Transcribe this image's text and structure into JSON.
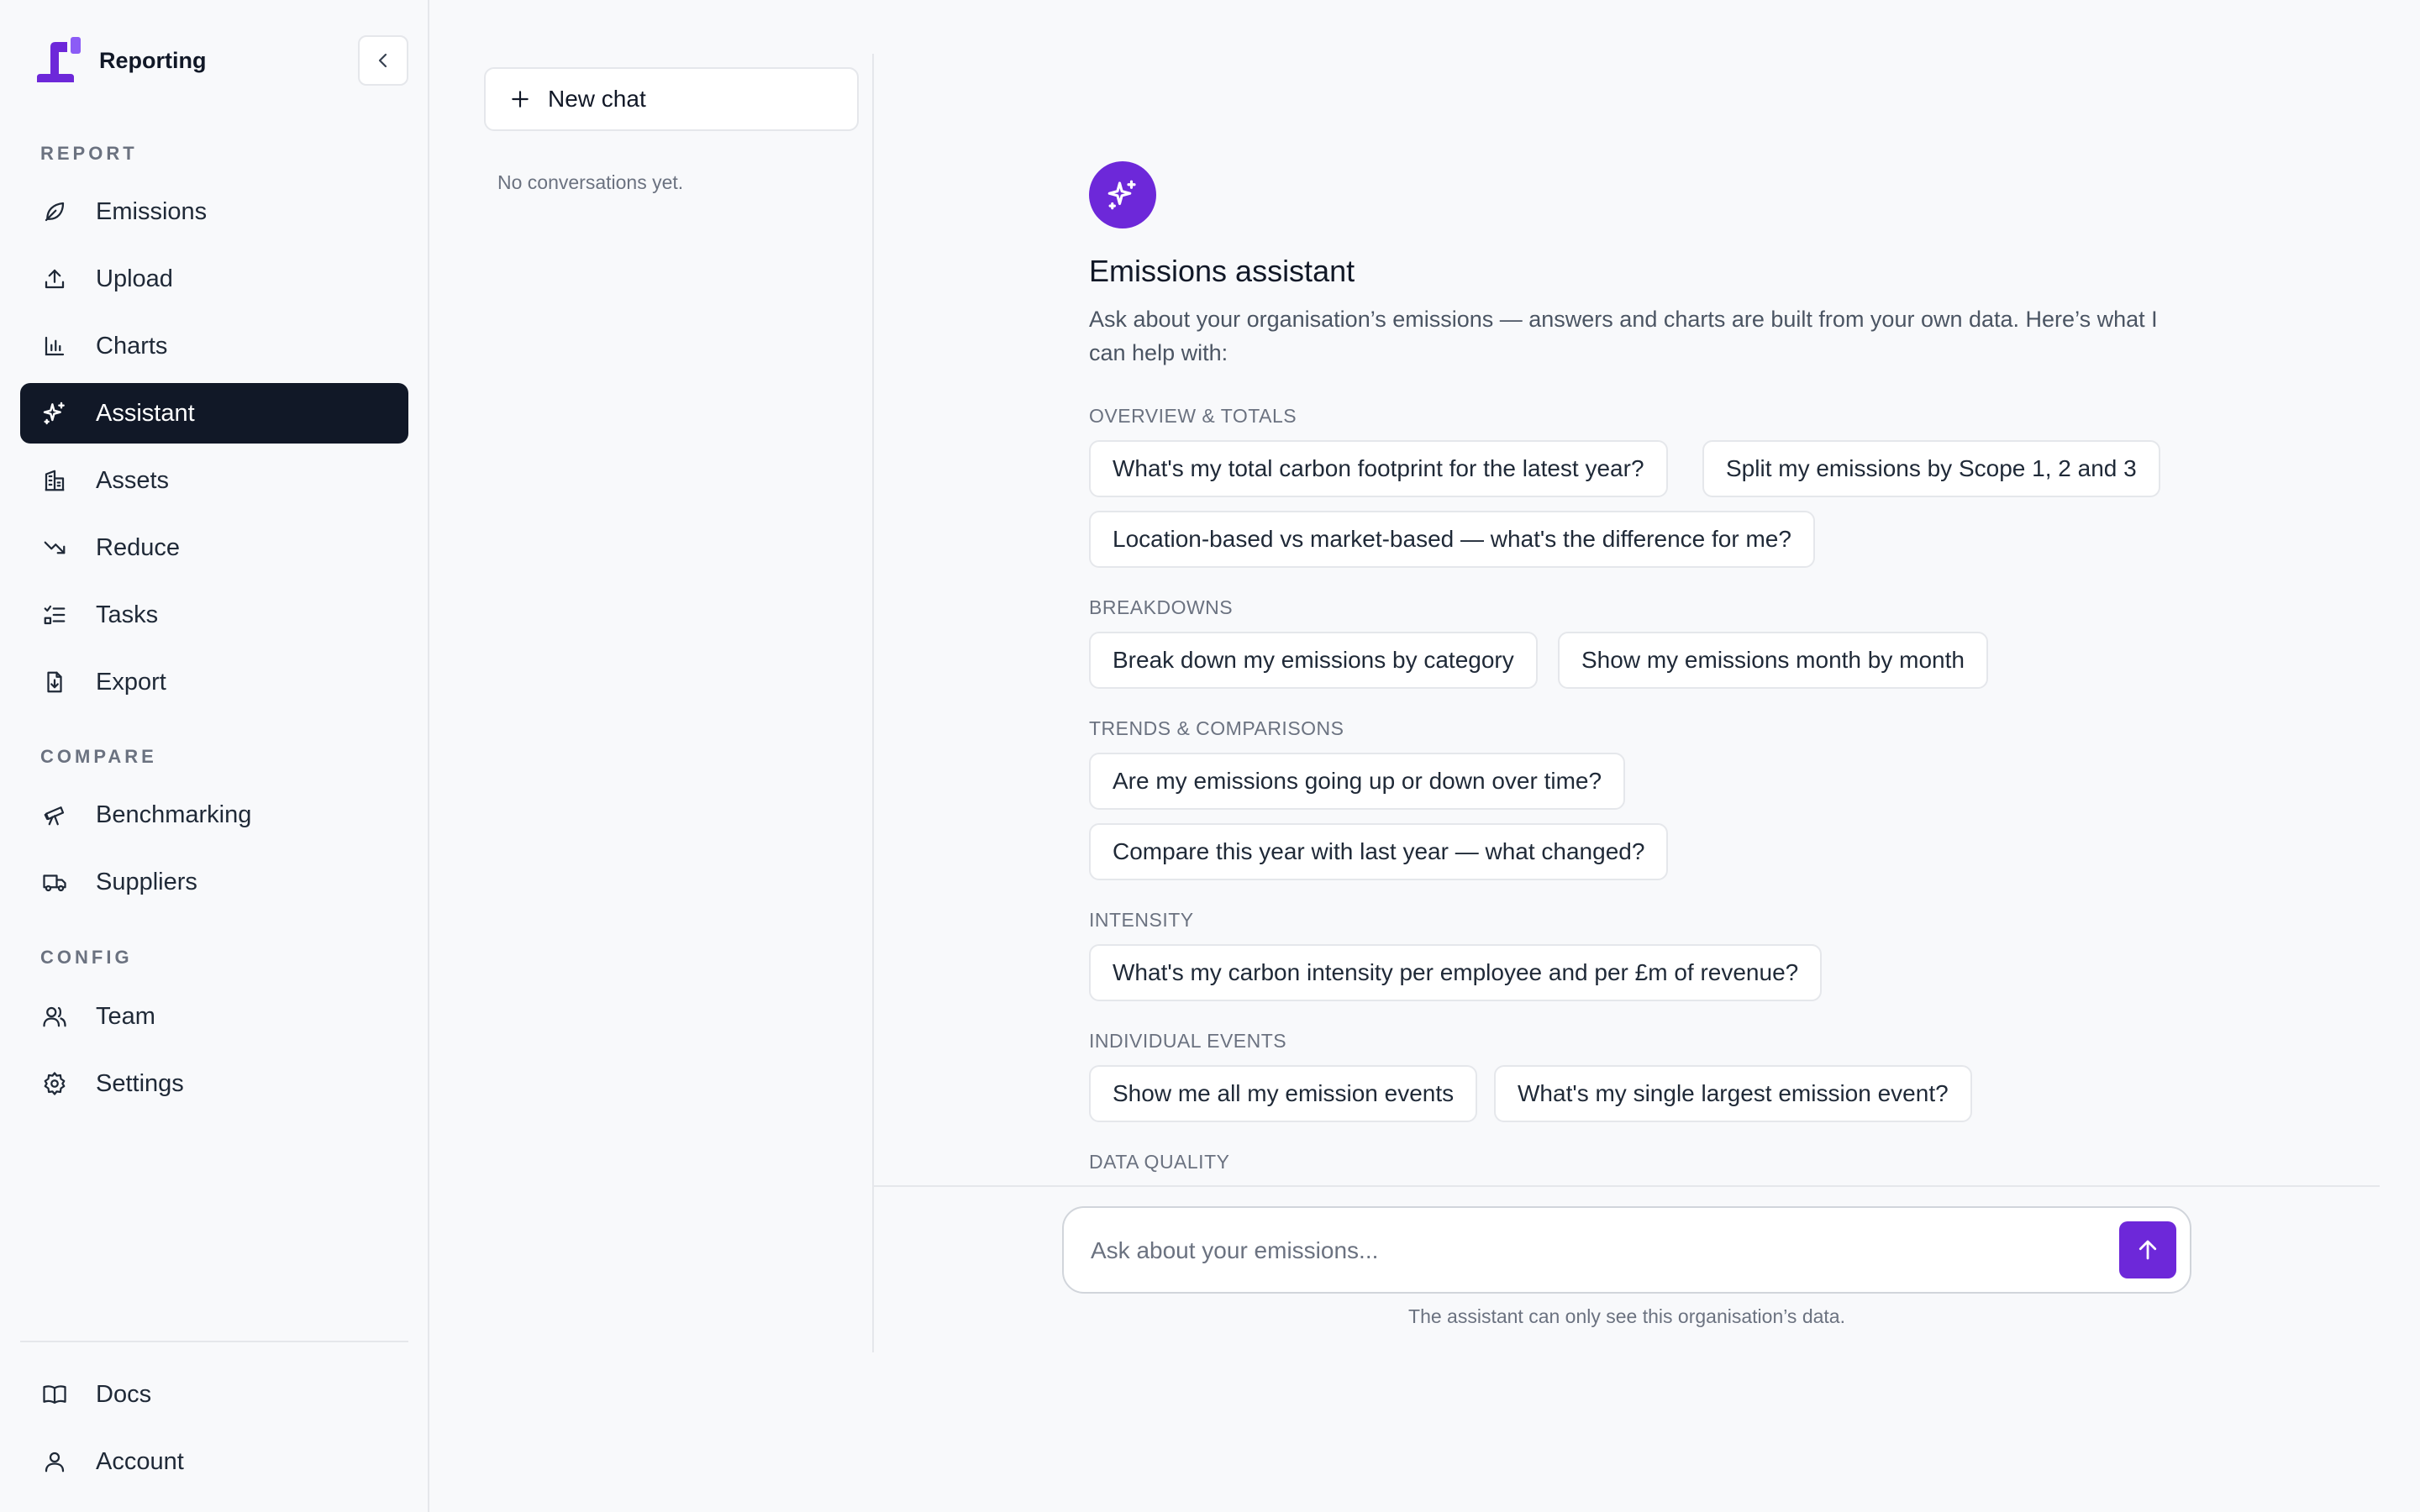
{
  "app": {
    "name": "Reporting"
  },
  "colors": {
    "accent": "#6d28d9",
    "active_nav": "#111827",
    "border": "#e5e7eb",
    "muted_text": "#6b7280"
  },
  "sidebar": {
    "sections": {
      "report": "REPORT",
      "compare": "COMPARE",
      "config": "CONFIG"
    },
    "items": [
      {
        "label": "Emissions",
        "icon": "leaf-icon"
      },
      {
        "label": "Upload",
        "icon": "upload-icon"
      },
      {
        "label": "Charts",
        "icon": "bar-chart-icon"
      },
      {
        "label": "Assistant",
        "icon": "sparkles-icon",
        "active": true
      },
      {
        "label": "Assets",
        "icon": "building-icon"
      },
      {
        "label": "Reduce",
        "icon": "trending-down-icon"
      },
      {
        "label": "Tasks",
        "icon": "list-checks-icon"
      },
      {
        "label": "Export",
        "icon": "file-export-icon"
      },
      {
        "label": "Benchmarking",
        "icon": "telescope-icon"
      },
      {
        "label": "Suppliers",
        "icon": "truck-icon"
      },
      {
        "label": "Team",
        "icon": "users-icon"
      },
      {
        "label": "Settings",
        "icon": "gear-icon"
      },
      {
        "label": "Docs",
        "icon": "book-icon"
      },
      {
        "label": "Account",
        "icon": "user-icon"
      }
    ]
  },
  "conversations": {
    "new_chat_label": "New chat",
    "empty_text": "No conversations yet."
  },
  "assistant": {
    "title": "Emissions assistant",
    "description": "Ask about your organisation’s emissions — answers and charts are built from your own data. Here’s what I can help with:",
    "categories": [
      {
        "title": "OVERVIEW & TOTALS",
        "prompts": [
          "What's my total carbon footprint for the latest year?",
          "Split my emissions by Scope 1, 2 and 3",
          "Location-based vs market-based — what's the difference for me?"
        ]
      },
      {
        "title": "BREAKDOWNS",
        "prompts": [
          "Break down my emissions by category",
          "Show my emissions month by month"
        ]
      },
      {
        "title": "TRENDS & COMPARISONS",
        "prompts": [
          "Are my emissions going up or down over time?",
          "Compare this year with last year — what changed?"
        ]
      },
      {
        "title": "INTENSITY",
        "prompts": [
          "What's my carbon intensity per employee and per £m of revenue?"
        ]
      },
      {
        "title": "INDIVIDUAL EVENTS",
        "prompts": [
          "Show me all my emission events",
          "What's my single largest emission event?"
        ]
      },
      {
        "title": "DATA QUALITY",
        "prompts": []
      }
    ]
  },
  "composer": {
    "placeholder": "Ask about your emissions...",
    "disclaimer": "The assistant can only see this organisation’s data."
  }
}
